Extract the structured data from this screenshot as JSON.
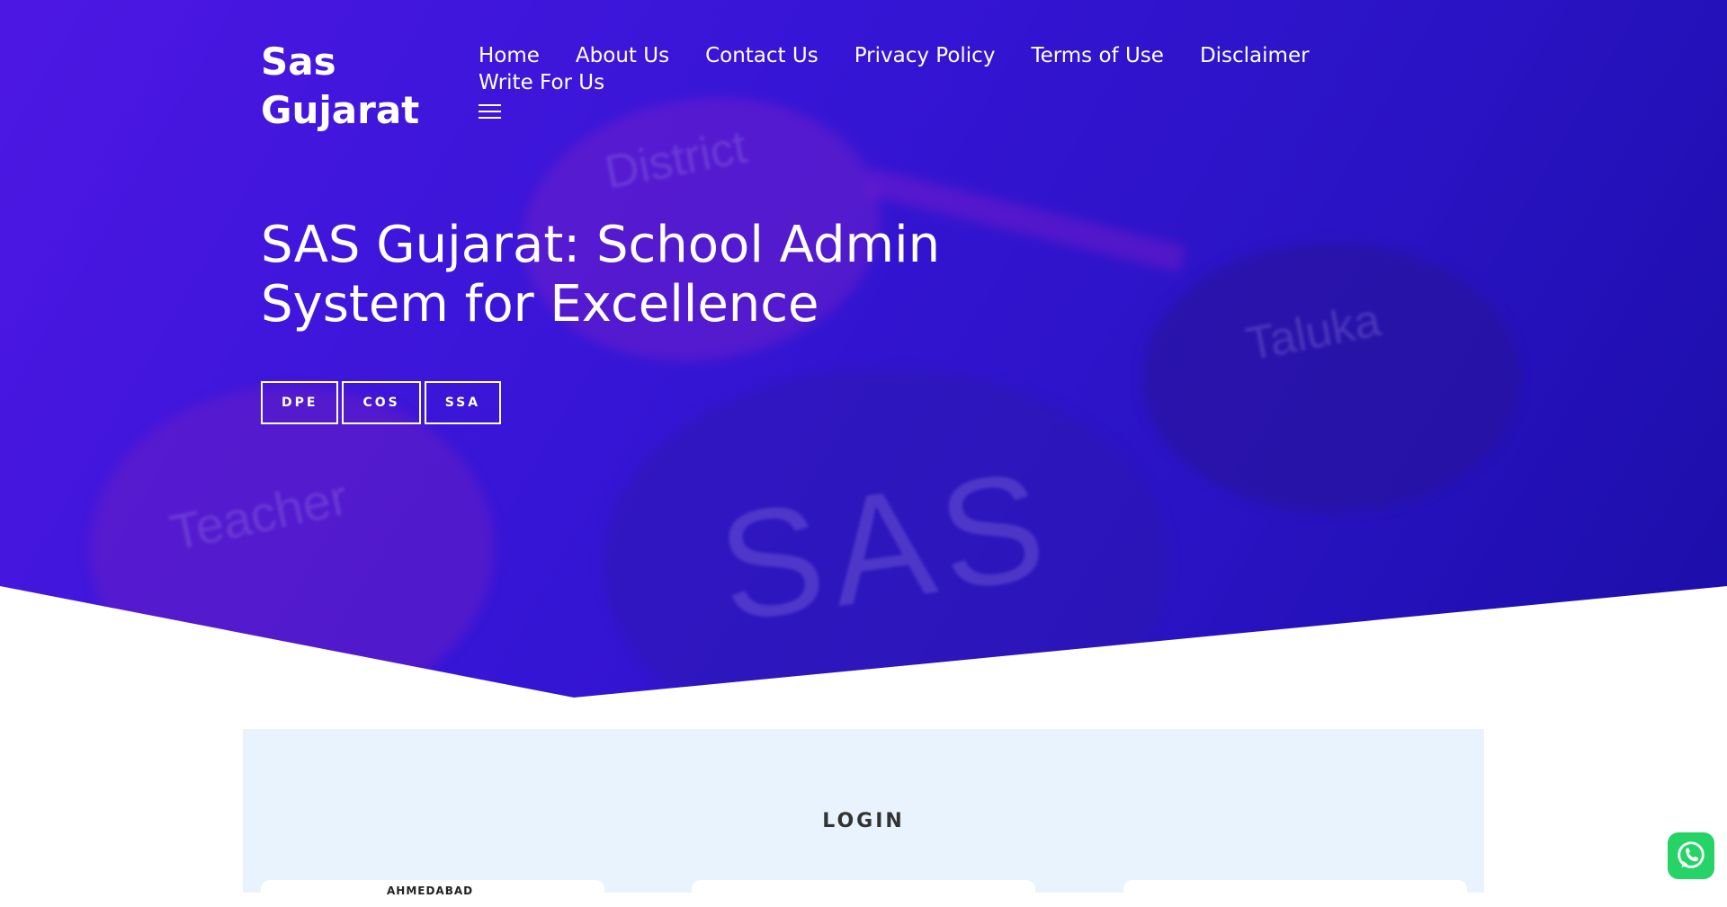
{
  "site": {
    "title": "Sas Gujarat"
  },
  "nav": {
    "items": [
      {
        "label": "Home"
      },
      {
        "label": "About Us"
      },
      {
        "label": "Contact Us"
      },
      {
        "label": "Privacy Policy"
      },
      {
        "label": "Terms of Use"
      },
      {
        "label": "Disclaimer"
      },
      {
        "label": "Write For Us"
      }
    ],
    "menu_icon": "hamburger-icon"
  },
  "hero": {
    "headline": "SAS Gujarat: School Admin System for Excellence",
    "background_words": [
      "District",
      "Taluka",
      "Teacher",
      "SAS"
    ],
    "tags": [
      {
        "label": "DPE"
      },
      {
        "label": "COS"
      },
      {
        "label": "SSA"
      }
    ]
  },
  "login": {
    "title": "LOGIN",
    "cards": [
      {
        "label": "AHMEDABAD"
      },
      {
        "label": ""
      },
      {
        "label": ""
      }
    ]
  },
  "whatsapp": {
    "icon": "whatsapp-icon"
  },
  "colors": {
    "hero_start": "#4d17e3",
    "hero_end": "#1b0ea8",
    "login_bg": "#e9f3fe",
    "whatsapp": "#25d366"
  }
}
